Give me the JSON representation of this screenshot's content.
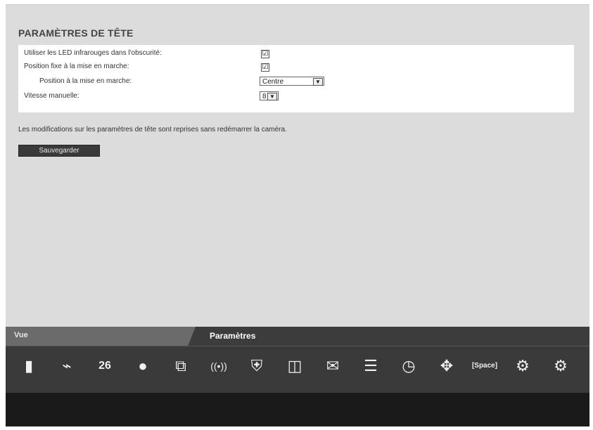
{
  "page": {
    "title": "PARAMÈTRES DE TÊTE",
    "settings": {
      "infrared_label": "Utiliser les LED infrarouges dans l'obscurité:",
      "infrared_checked": "☑",
      "fixed_label": "Position fixe à la mise en marche:",
      "fixed_checked": "☑",
      "startup_position_label": "Position à la mise en marche:",
      "startup_position_value": "Centre",
      "speed_label": "Vitesse manuelle:",
      "speed_value": "8"
    },
    "note": "Les modifications sur les paramètres de tête sont reprises sans redémarrer la caméra.",
    "save_label": "Sauvegarder"
  },
  "tabs": {
    "vue": "Vue",
    "parametres": "Paramètres"
  },
  "icons": [
    {
      "name": "traffic-light-icon",
      "glyph": "▮"
    },
    {
      "name": "camera-icon",
      "glyph": "⌁"
    },
    {
      "name": "calendar-icon",
      "glyph": "26"
    },
    {
      "name": "user-icon",
      "glyph": "●"
    },
    {
      "name": "network-icon",
      "glyph": "⧉"
    },
    {
      "name": "wireless-icon",
      "glyph": "((•))"
    },
    {
      "name": "shield-icon",
      "glyph": "⛨"
    },
    {
      "name": "web-icon",
      "glyph": "◫"
    },
    {
      "name": "mail-icon",
      "glyph": "✉"
    },
    {
      "name": "storage-icon",
      "glyph": "☰"
    },
    {
      "name": "alarm-clock-icon",
      "glyph": "◷"
    },
    {
      "name": "pan-tilt-icon",
      "glyph": "✥"
    },
    {
      "name": "space-icon",
      "glyph": "[Space]"
    },
    {
      "name": "settings-gear-icon",
      "glyph": "⚙"
    },
    {
      "name": "settings-next-icon",
      "glyph": "⚙"
    }
  ]
}
